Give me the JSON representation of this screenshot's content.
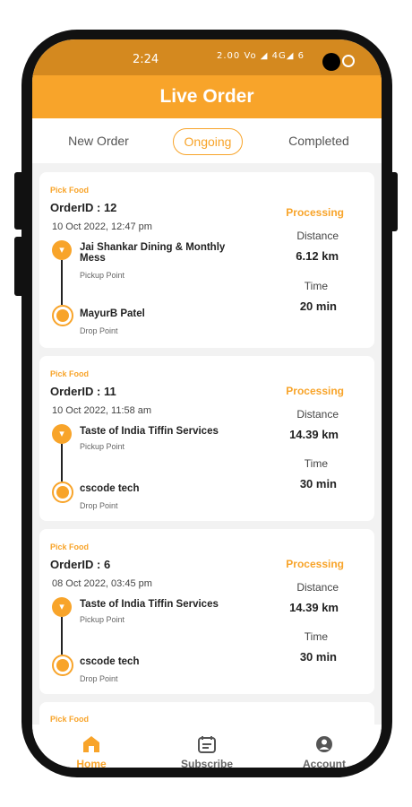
{
  "status_bar": {
    "time": "2:24",
    "icons": "2.00 Vo ◢ 4G◢ 6"
  },
  "header": {
    "title": "Live Order"
  },
  "tabs": [
    {
      "label": "New Order"
    },
    {
      "label": "Ongoing"
    },
    {
      "label": "Completed"
    }
  ],
  "orders": [
    {
      "kind": "Pick Food",
      "order_id": "OrderID : 12",
      "datetime": "10 Oct 2022, 12:47 pm",
      "pickup_name": "Jai Shankar Dining & Monthly Mess",
      "pickup_label": "Pickup Point",
      "drop_name": "MayurB Patel",
      "drop_label": "Drop Point",
      "status": "Processing",
      "distance_label": "Distance",
      "distance": "6.12 km",
      "time_label": "Time",
      "time": "20 min"
    },
    {
      "kind": "Pick Food",
      "order_id": "OrderID : 11",
      "datetime": "10 Oct 2022, 11:58 am",
      "pickup_name": "Taste of India Tiffin Services",
      "pickup_label": "Pickup Point",
      "drop_name": "cscode tech",
      "drop_label": "Drop Point",
      "status": "Processing",
      "distance_label": "Distance",
      "distance": "14.39 km",
      "time_label": "Time",
      "time": "30 min"
    },
    {
      "kind": "Pick Food",
      "order_id": "OrderID : 6",
      "datetime": "08 Oct 2022, 03:45 pm",
      "pickup_name": "Taste of India Tiffin Services",
      "pickup_label": "Pickup Point",
      "drop_name": "cscode tech",
      "drop_label": "Drop Point",
      "status": "Processing",
      "distance_label": "Distance",
      "distance": "14.39 km",
      "time_label": "Time",
      "time": "30 min"
    },
    {
      "kind": "Pick Food"
    }
  ],
  "bottom_nav": [
    {
      "label": "Home",
      "icon": "home-icon"
    },
    {
      "label": "Subscribe",
      "icon": "calendar-icon"
    },
    {
      "label": "Account",
      "icon": "user-icon"
    }
  ],
  "colors": {
    "accent": "#f8a42a",
    "status_bar": "#d4891f"
  }
}
